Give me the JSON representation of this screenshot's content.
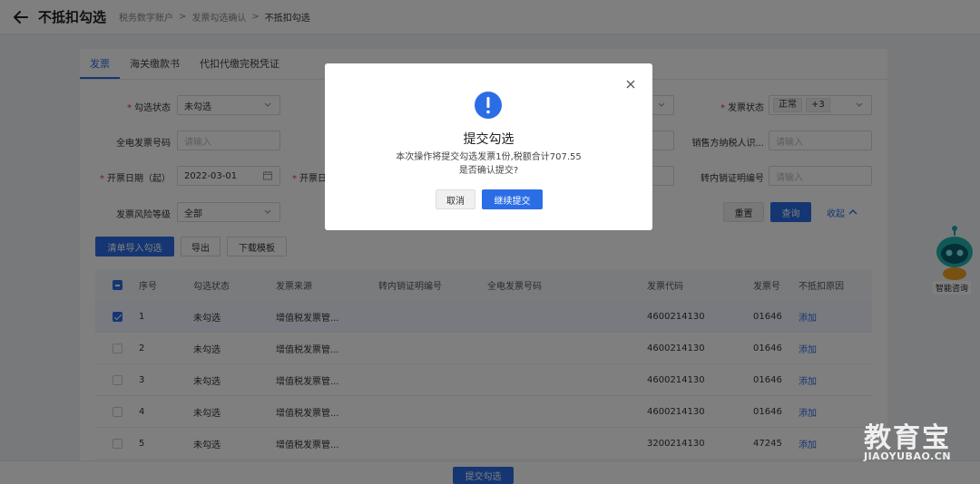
{
  "header": {
    "title": "不抵扣勾选",
    "breadcrumb": [
      "税务数字账户",
      "发票勾选确认",
      "不抵扣勾选"
    ]
  },
  "tabs": [
    "发票",
    "海关缴款书",
    "代扣代缴完税凭证"
  ],
  "filters": {
    "select_status_label": "勾选状态",
    "select_status_value": "未勾选",
    "invoice_status_label": "发票状态",
    "invoice_status_tag1": "正常",
    "invoice_status_tag2": "+3",
    "full_invoice_no_label": "全电发票号码",
    "full_invoice_no_placeholder": "请输入",
    "seller_tax_id_label": "销售方纳税人识...",
    "seller_tax_id_placeholder": "请输入",
    "date_start_label": "开票日期（起）",
    "date_start_value": "2022-03-01",
    "date_end_label_partial": "开票日",
    "transfer_cert_label": "转内销证明编号",
    "transfer_cert_placeholder": "请输入",
    "risk_level_label": "发票风险等级",
    "risk_level_value": "全部",
    "reset": "重置",
    "query": "查询",
    "collapse": "收起"
  },
  "toolbar": {
    "list_import": "清单导入勾选",
    "export": "导出",
    "download_template": "下载模板"
  },
  "table": {
    "columns": [
      "序号",
      "勾选状态",
      "发票来源",
      "转内销证明编号",
      "全电发票号码",
      "发票代码",
      "发票号",
      "不抵扣原因"
    ],
    "rows": [
      {
        "no": "1",
        "status": "未勾选",
        "source": "增值税发票管...",
        "code": "4600214130",
        "number": "01646",
        "action": "添加"
      },
      {
        "no": "2",
        "status": "未勾选",
        "source": "增值税发票管...",
        "code": "4600214130",
        "number": "01646",
        "action": "添加"
      },
      {
        "no": "3",
        "status": "未勾选",
        "source": "增值税发票管...",
        "code": "4600214130",
        "number": "01646",
        "action": "添加"
      },
      {
        "no": "4",
        "status": "未勾选",
        "source": "增值税发票管...",
        "code": "4600214130",
        "number": "01646",
        "action": "添加"
      },
      {
        "no": "5",
        "status": "未勾选",
        "source": "增值税发票管...",
        "code": "3200214130",
        "number": "47245",
        "action": "添加"
      }
    ]
  },
  "footer": {
    "submit": "提交勾选"
  },
  "assistant": {
    "label": "智能咨询"
  },
  "watermark": {
    "main": "教育宝",
    "sub": "JIAOYUBAO.CN"
  },
  "modal": {
    "title": "提交勾选",
    "line1": "本次操作将提交勾选发票1份,税额合计707.55",
    "line2": "是否确认提交?",
    "cancel": "取消",
    "confirm": "继续提交"
  }
}
